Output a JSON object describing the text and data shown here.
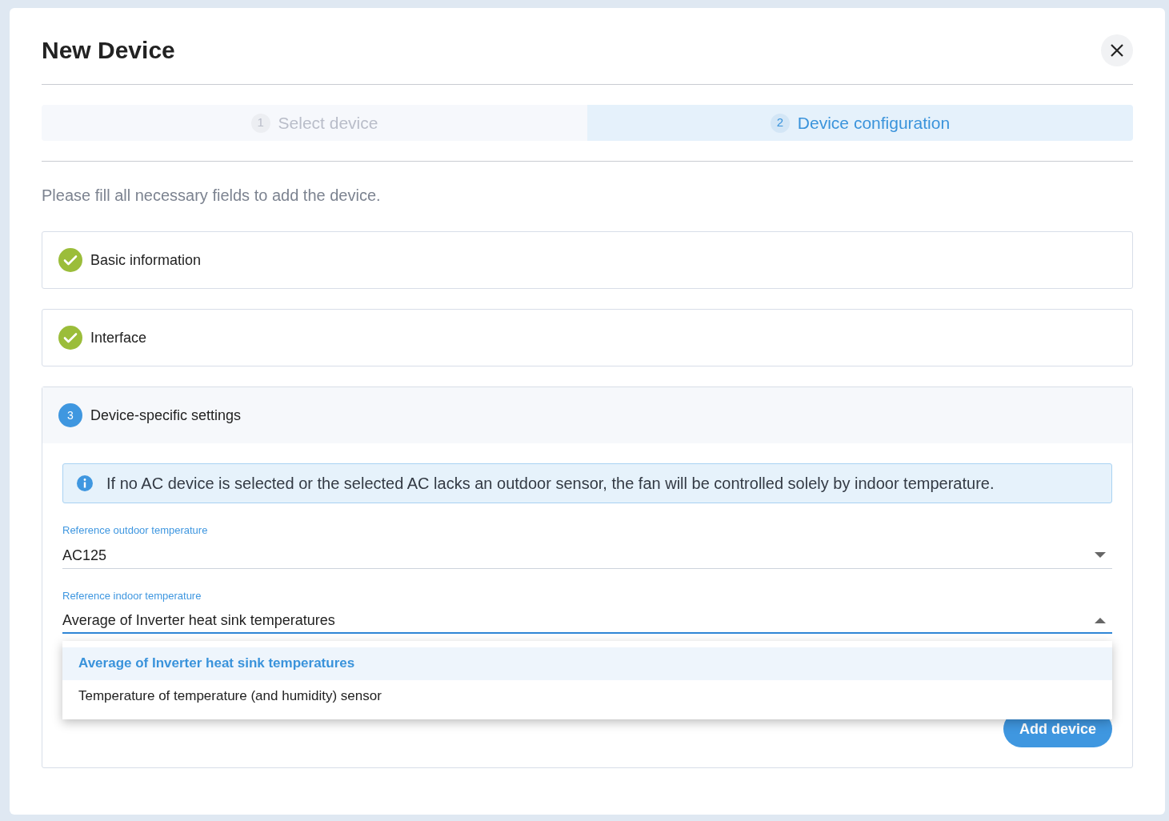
{
  "dialog": {
    "title": "New Device"
  },
  "steps": [
    {
      "number": "1",
      "label": "Select device",
      "selected": false
    },
    {
      "number": "2",
      "label": "Device configuration",
      "selected": true
    }
  ],
  "intro": "Please fill all necessary fields to add the device.",
  "sections": [
    {
      "kind": "check",
      "title": "Basic information",
      "expanded": false
    },
    {
      "kind": "check",
      "title": "Interface",
      "expanded": false
    },
    {
      "kind": "number",
      "number": "3",
      "title": "Device-specific settings",
      "expanded": true
    }
  ],
  "info": "If no AC device is selected or the selected AC lacks an outdoor sensor, the fan will be controlled solely by indoor temperature.",
  "fields": [
    {
      "label": "Reference outdoor temperature",
      "value": "AC125",
      "open": false
    },
    {
      "label": "Reference indoor temperature",
      "value": "Average of Inverter heat sink temperatures",
      "open": true
    }
  ],
  "menu": [
    {
      "label": "Average of Inverter heat sink temperatures",
      "selected": true
    },
    {
      "label": "Temperature of temperature (and humidity) sensor",
      "selected": false
    }
  ],
  "primary_button": "Add device"
}
